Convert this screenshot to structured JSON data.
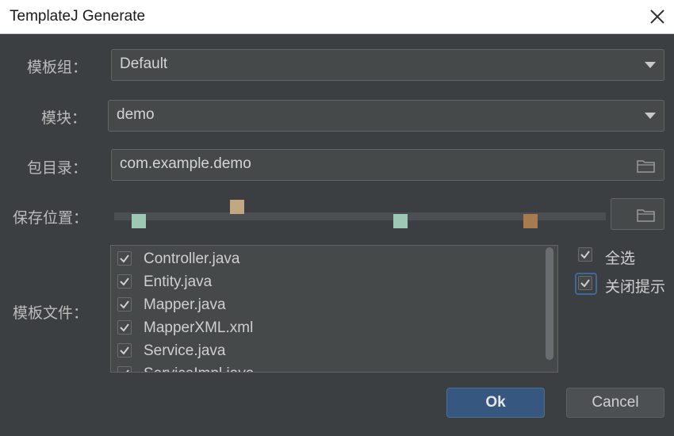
{
  "window": {
    "title": "TemplateJ Generate"
  },
  "form": {
    "template_group": {
      "label": "模板组：",
      "value": "Default"
    },
    "module": {
      "label": "模块：",
      "value": "demo"
    },
    "package": {
      "label": "包目录：",
      "value": "com.example.demo"
    },
    "save_path": {
      "label": "保存位置：",
      "value": ""
    },
    "template_files": {
      "label": "模板文件："
    }
  },
  "files": [
    {
      "name": "Controller.java",
      "checked": true
    },
    {
      "name": "Entity.java",
      "checked": true
    },
    {
      "name": "Mapper.java",
      "checked": true
    },
    {
      "name": "MapperXML.xml",
      "checked": true
    },
    {
      "name": "Service.java",
      "checked": true
    },
    {
      "name": "ServiceImpl.java",
      "checked": true
    }
  ],
  "options": {
    "select_all": {
      "label": "全选",
      "checked": true
    },
    "close_prompt": {
      "label": "关闭提示",
      "checked": true
    }
  },
  "buttons": {
    "ok": "Ok",
    "cancel": "Cancel"
  },
  "colors": {
    "background": "#3c3f41",
    "field": "#45494a",
    "primary_button": "#365880",
    "focus": "#3d6a9e"
  },
  "icons": {
    "close": "close-icon",
    "dropdown": "chevron-down-icon",
    "folder": "folder-icon",
    "check": "checkmark-icon"
  }
}
